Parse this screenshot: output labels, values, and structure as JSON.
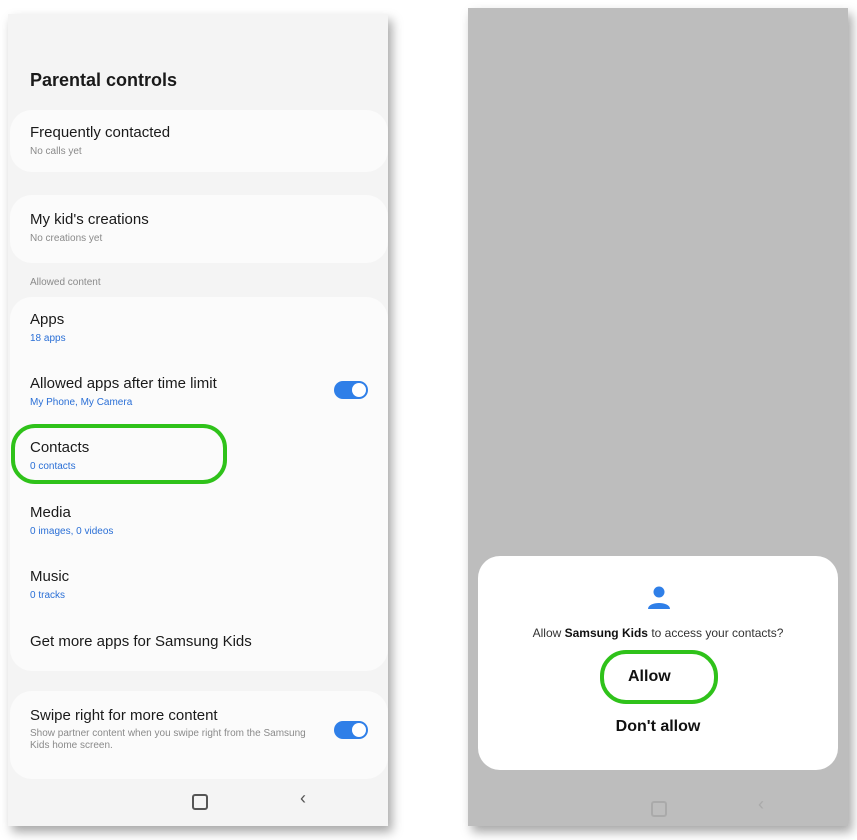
{
  "parental": {
    "title": "Parental controls",
    "frequently_contacted": {
      "title": "Frequently contacted",
      "sub": "No calls yet"
    },
    "creations": {
      "title": "My kid's creations",
      "sub": "No creations yet"
    },
    "allowed_label": "Allowed content",
    "apps": {
      "title": "Apps",
      "sub": "18 apps"
    },
    "allowed_after": {
      "title": "Allowed apps after time limit",
      "sub": "My Phone, My Camera",
      "toggle_on": true
    },
    "contacts": {
      "title": "Contacts",
      "sub": "0 contacts"
    },
    "media": {
      "title": "Media",
      "sub": "0 images, 0 videos"
    },
    "music": {
      "title": "Music",
      "sub": "0 tracks"
    },
    "get_more": {
      "title": "Get more apps for Samsung Kids"
    },
    "swipe": {
      "title": "Swipe right for more content",
      "sub": "Show partner content when you swipe right from the Samsung Kids home screen.",
      "toggle_on": true
    },
    "nav_back": "‹"
  },
  "dialog": {
    "text_pre": "Allow ",
    "app_name": "Samsung Kids",
    "text_post": " to access your contacts?",
    "allow_label": "Allow",
    "deny_label": "Don't allow",
    "nav_back": "‹"
  },
  "colors": {
    "accent": "#2f7fe8",
    "highlight": "#2fc21a"
  },
  "icons": [
    "person-icon",
    "home-icon",
    "back-icon"
  ]
}
